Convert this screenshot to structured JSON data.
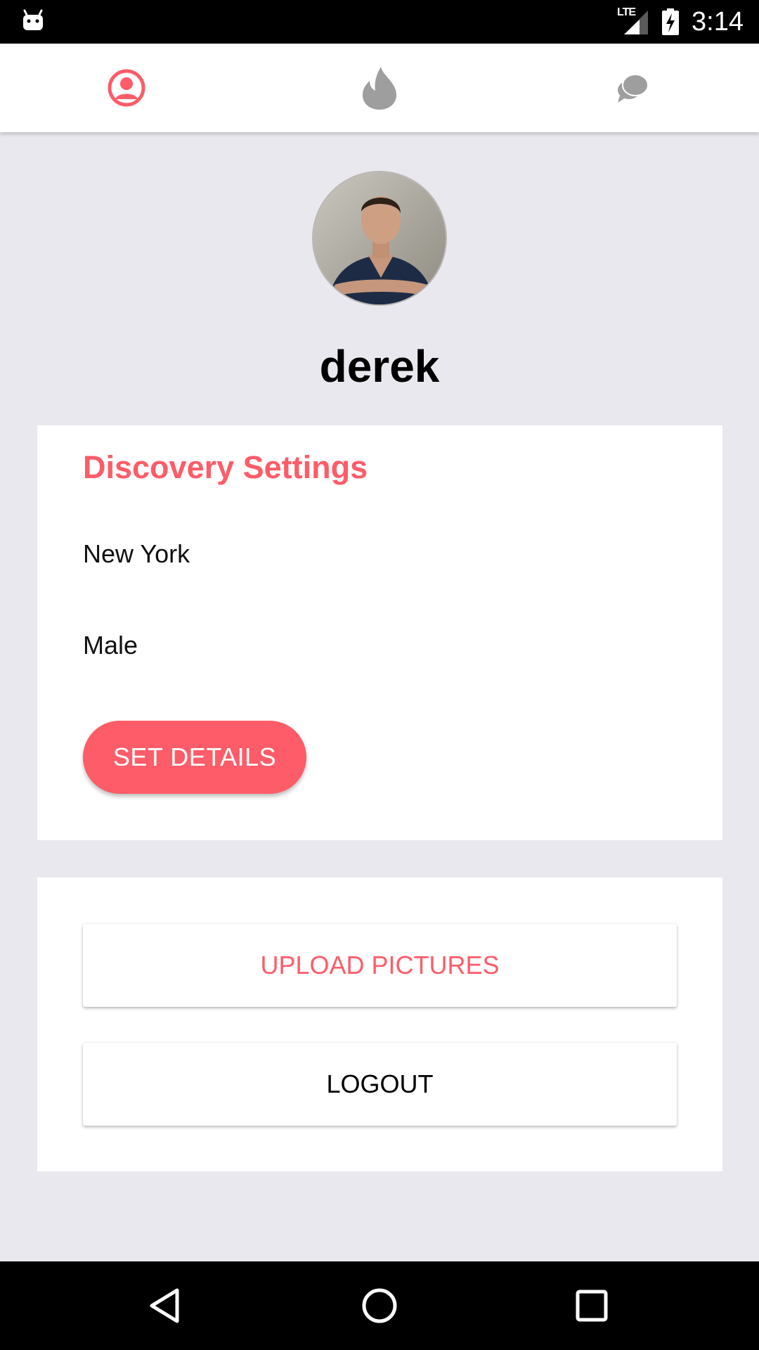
{
  "status_bar": {
    "left_icon": "android-debug-icon",
    "network": "LTE",
    "time": "3:14"
  },
  "tabs": [
    {
      "icon": "person-icon",
      "active": true
    },
    {
      "icon": "flame-icon",
      "active": false
    },
    {
      "icon": "chat-bubbles-icon",
      "active": false
    }
  ],
  "profile": {
    "name": "derek",
    "avatar": "profile-photo"
  },
  "discovery": {
    "title": "Discovery Settings",
    "city": "New York",
    "gender": "Male",
    "set_details_label": "SET DETAILS"
  },
  "actions": {
    "upload_label": "UPLOAD PICTURES",
    "logout_label": "LOGOUT"
  },
  "nav": [
    "back-icon",
    "home-icon",
    "recents-icon"
  ],
  "colors": {
    "accent": "#fd5c68",
    "background": "#e9e8ef",
    "inactive_icon": "#9e9e9e"
  }
}
